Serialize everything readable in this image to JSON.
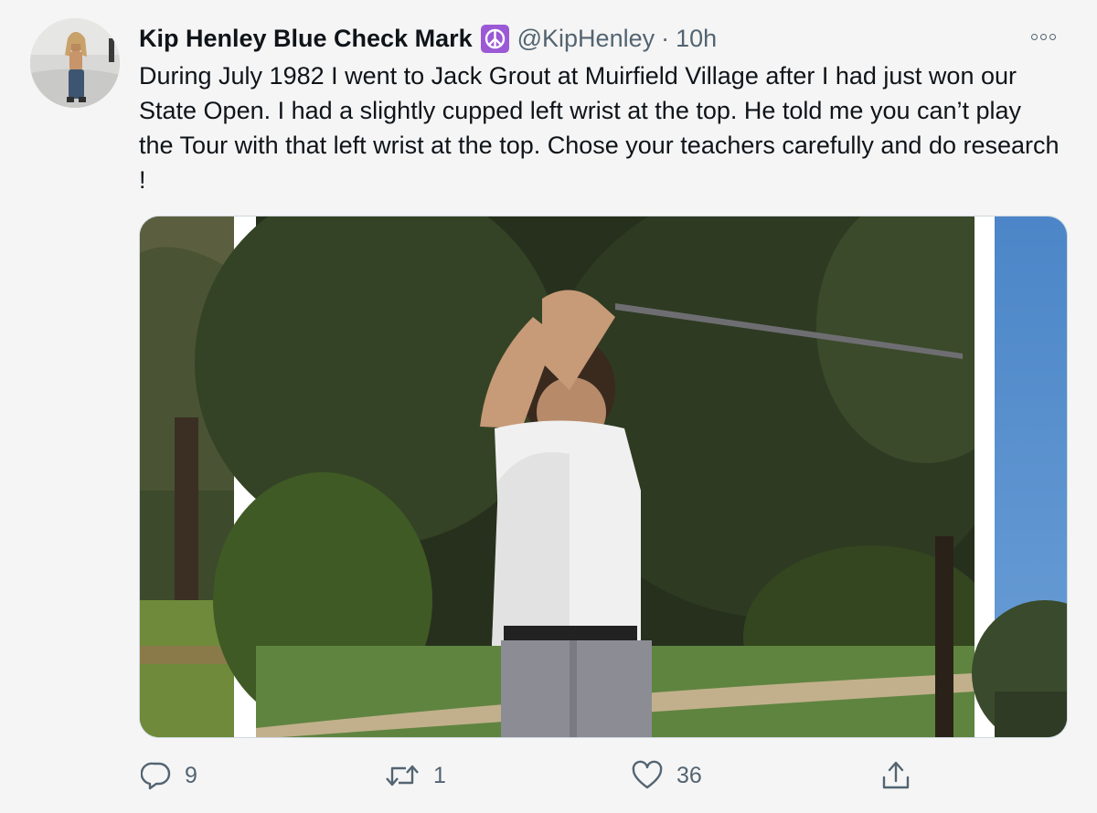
{
  "tweet": {
    "display_name": "Kip Henley Blue Check Mark",
    "badge_icon": "peace-symbol-icon",
    "handle": "@KipHenley",
    "separator": "·",
    "time": "10h",
    "text": "During July 1982 I went to Jack Grout at Muirfield Village after I had just won our State Open. I had a slightly cupped left wrist at the top. He told me you can’t play the Tour with that left wrist at the top. Chose your teachers carefully and do research !"
  },
  "actions": {
    "reply_count": "9",
    "retweet_count": "1",
    "like_count": "36"
  },
  "colors": {
    "secondary_text": "#536471",
    "badge_purple": "#9b59d6",
    "media_border": "#cfd9de"
  }
}
